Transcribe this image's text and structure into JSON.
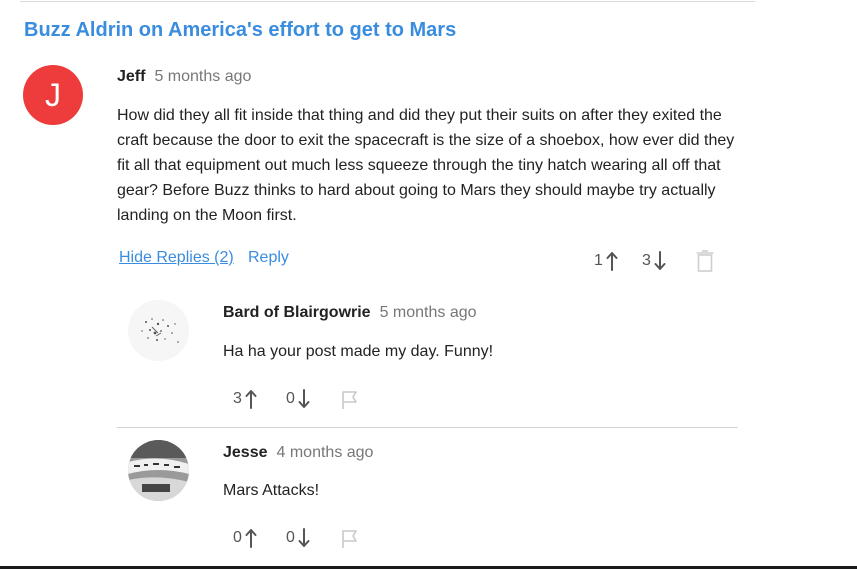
{
  "article": {
    "title": "Buzz Aldrin on America's effort to get to Mars"
  },
  "comment": {
    "avatar_letter": "J",
    "avatar_color": "#ee3b3b",
    "author": "Jeff",
    "time": "5 months ago",
    "text": "How did they all fit inside that thing and did they put their suits on after they exited the craft because the door to exit the spacecraft is the size of a shoebox, how ever did they fit all that equipment out much less squeeze through the tiny hatch wearing all off that gear? Before Buzz thinks to hard about going to Mars they should maybe try actually landing on the Moon first.",
    "hide_replies_label": "Hide Replies (2)",
    "reply_label": "Reply",
    "upvotes": "1",
    "downvotes": "3",
    "action_icon": "trash-icon"
  },
  "replies": [
    {
      "author": "Bard of Blairgowrie",
      "time": "5 months ago",
      "text": "Ha ha your post made my day. Funny!",
      "upvotes": "3",
      "downvotes": "0",
      "action_icon": "flag-icon"
    },
    {
      "author": "Jesse",
      "time": "4 months ago",
      "text": "Mars Attacks!",
      "upvotes": "0",
      "downvotes": "0",
      "action_icon": "flag-icon"
    }
  ],
  "colors": {
    "link": "#3a8dde",
    "muted": "#777777",
    "icon": "#555555",
    "icon_light": "#c8c8c8"
  }
}
